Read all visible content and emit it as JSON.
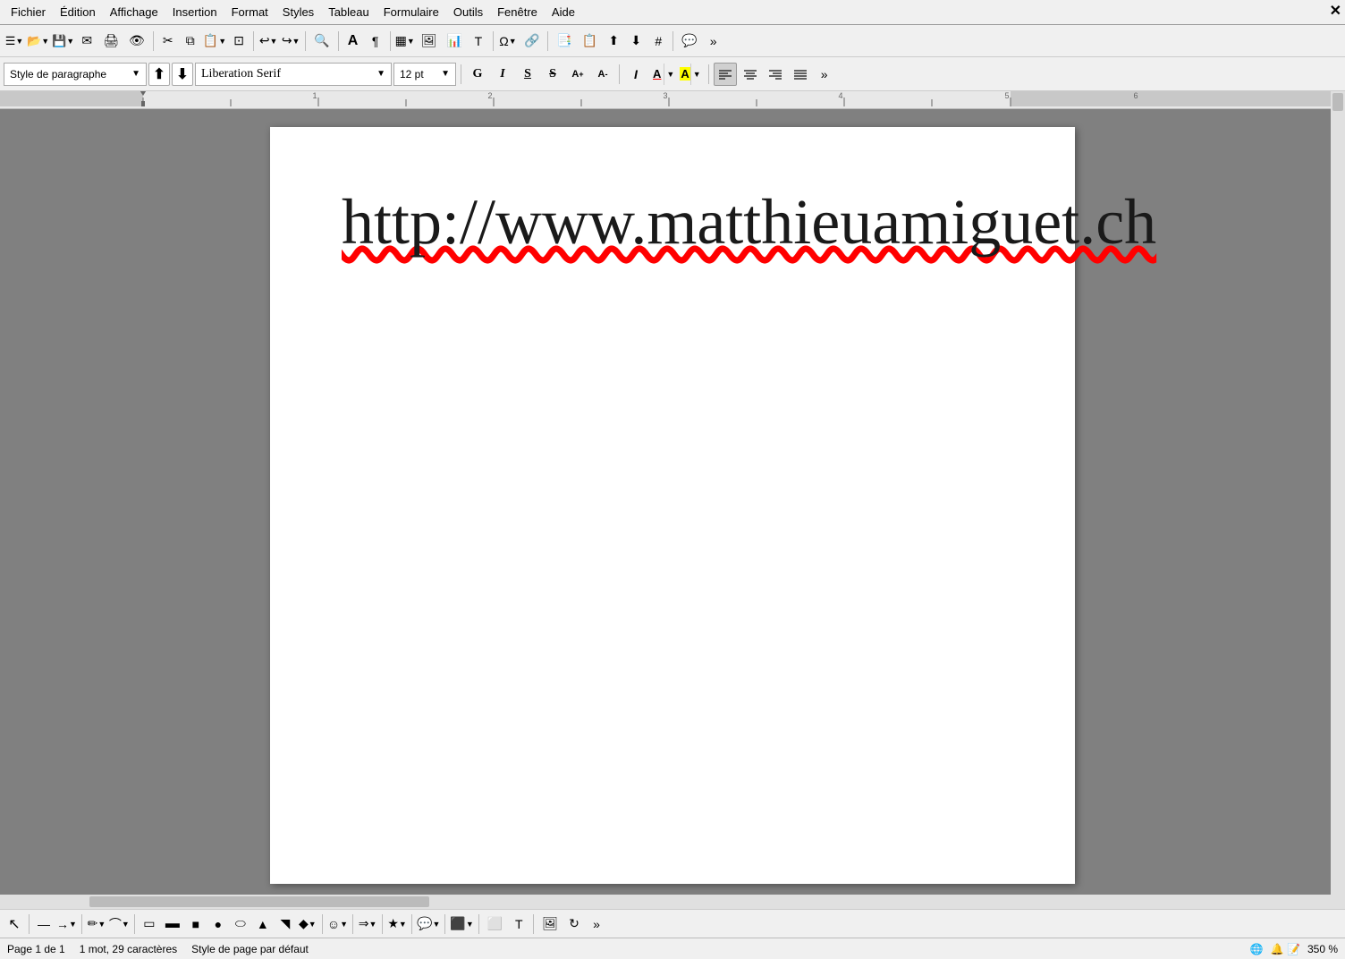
{
  "menubar": {
    "items": [
      "Fichier",
      "Édition",
      "Affichage",
      "Insertion",
      "Format",
      "Styles",
      "Tableau",
      "Formulaire",
      "Outils",
      "Fenêtre",
      "Aide"
    ]
  },
  "toolbar1": {
    "buttons": [
      "☰",
      "📂",
      "💾",
      "🖨",
      "👁",
      "✂",
      "📋",
      "🔄",
      "↩",
      "↪",
      "🔍",
      "A",
      "¶",
      "▦",
      "🖼",
      "📊",
      "T",
      "⬜",
      "☰",
      "Ω",
      "🔗",
      "📑",
      "📋",
      "📱",
      "📄",
      "💬",
      "◻"
    ]
  },
  "formatting": {
    "paragraph_style": "Style de paragraphe",
    "font_name": "Liberation Serif",
    "font_size": "12 pt",
    "buttons": {
      "bold": "G",
      "italic": "I",
      "underline": "S",
      "strikethrough": "S̶",
      "superscript": "A",
      "subscript": "A",
      "italic_style": "I",
      "font_color": "A",
      "highlight": "A",
      "align_left": "≡",
      "align_center": "≡",
      "align_right": "≡",
      "justify": "≡"
    }
  },
  "content": {
    "url_text": "http://www.matthieuamiguet.ch"
  },
  "statusbar": {
    "page_info": "Page 1 de 1",
    "word_count": "1 mot, 29 caractères",
    "page_style": "Style de page par défaut",
    "zoom": "350 %"
  }
}
